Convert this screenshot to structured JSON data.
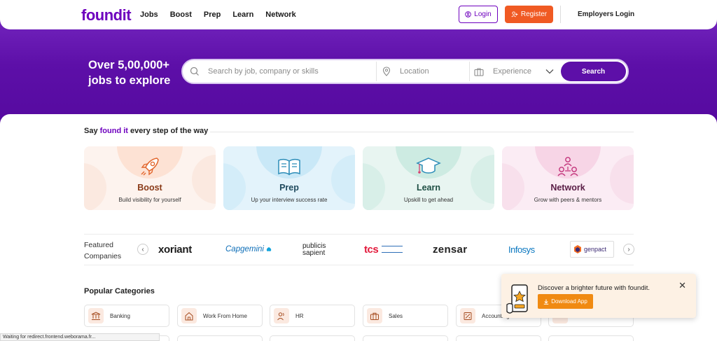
{
  "header": {
    "logo": "foundit",
    "nav": [
      "Jobs",
      "Boost",
      "Prep",
      "Learn",
      "Network"
    ],
    "login_label": "Login",
    "register_label": "Register",
    "employers_label": "Employers Login"
  },
  "hero": {
    "title": "Over 5,00,000+ jobs to explore",
    "search_placeholder": "Search by job, company or skills",
    "location_placeholder": "Location",
    "experience_placeholder": "Experience",
    "search_button": "Search"
  },
  "tagline": {
    "prefix": "Say ",
    "accent": "found it",
    "suffix": " every step of the way"
  },
  "cards": [
    {
      "title": "Boost",
      "subtitle": "Build visibility for yourself",
      "icon": "rocket-icon",
      "color": "#8a3a17"
    },
    {
      "title": "Prep",
      "subtitle": "Up your interview success rate",
      "icon": "book-icon",
      "color": "#1f4a5e"
    },
    {
      "title": "Learn",
      "subtitle": "Upskill to get ahead",
      "icon": "graduation-cap-icon",
      "color": "#1e4f44"
    },
    {
      "title": "Network",
      "subtitle": "Grow with peers & mentors",
      "icon": "people-network-icon",
      "color": "#5a1d46"
    }
  ],
  "featured": {
    "label_line1": "Featured",
    "label_line2": "Companies",
    "companies": [
      "xoriant",
      "Capgemini",
      "publicis sapient",
      "tcs",
      "zensar",
      "Infosys",
      "genpact"
    ]
  },
  "popular": {
    "title": "Popular Categories",
    "categories": [
      "Banking",
      "Work From Home",
      "HR",
      "Sales",
      "Accounting",
      ""
    ]
  },
  "toast": {
    "text": "Discover a brighter future with foundit.",
    "button": "Download App"
  },
  "status": "Waiting for redirect.frontend.weborama.fr..."
}
